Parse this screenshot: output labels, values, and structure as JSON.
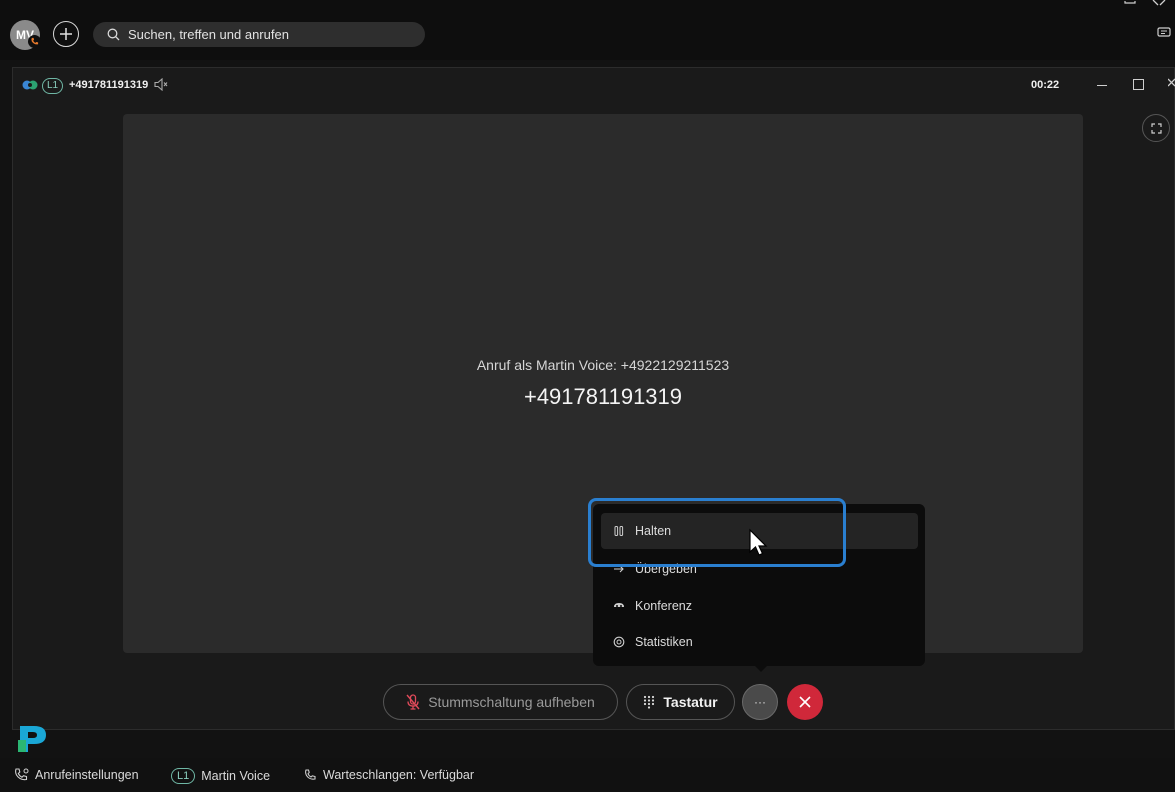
{
  "topbar": {
    "avatar_initials": "MV",
    "search_placeholder": "Suchen, treffen und anrufen"
  },
  "call": {
    "line_label": "L1",
    "number_small": "+491781191319",
    "timer": "00:22",
    "caller_info": "Anruf als Martin Voice: +4922129211523",
    "caller_number": "+491781191319"
  },
  "menu": {
    "items": [
      {
        "label": "Halten",
        "icon": "pause-icon"
      },
      {
        "label": "Übergeben",
        "icon": "transfer-arrow-icon"
      },
      {
        "label": "Konferenz",
        "icon": "conference-icon"
      },
      {
        "label": "Statistiken",
        "icon": "statistics-icon"
      }
    ]
  },
  "controls": {
    "unmute_label": "Stummschaltung aufheben",
    "keypad_label": "Tastatur",
    "more_label": "···"
  },
  "status": {
    "settings_label": "Anrufeinstellungen",
    "line_badge": "L1",
    "line_name": "Martin Voice",
    "queue_label": "Warteschlangen: Verfügbar"
  },
  "colors": {
    "highlight": "#2a7fd0",
    "end_call": "#d0283a",
    "line_badge": "#6fb7a5"
  }
}
